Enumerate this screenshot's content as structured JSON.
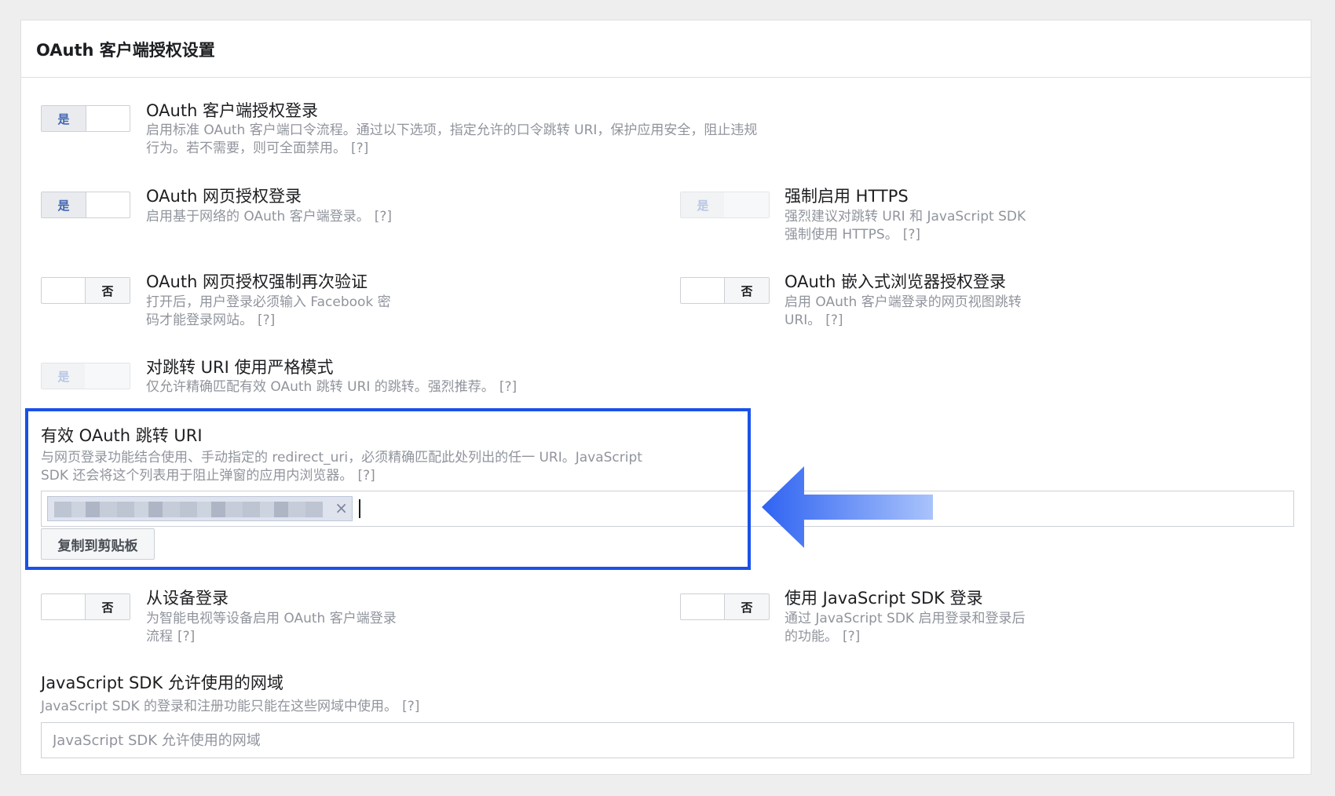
{
  "panel": {
    "title": "OAuth 客户端授权设置"
  },
  "settings": {
    "client_login": {
      "toggle": "是",
      "title": "OAuth 客户端授权登录",
      "desc_line1": "启用标准 OAuth 客户端口令流程。通过以下选项，指定允许的口令跳转 URI，保护应用安全，阻止违规",
      "desc_line2": "行为。若不需要，则可全面禁用。",
      "help": "[?]"
    },
    "web_login": {
      "toggle": "是",
      "title": "OAuth 网页授权登录",
      "desc_line1": "启用基于网络的 OAuth 客户端登录。",
      "help": "[?]"
    },
    "enforce_https": {
      "toggle": "是",
      "title": "强制启用 HTTPS",
      "desc_line1": "强烈建议对跳转 URI 和 JavaScript SDK",
      "desc_line2": "强制使用 HTTPS。",
      "help": "[?]"
    },
    "web_reauth": {
      "toggle": "否",
      "title": "OAuth 网页授权强制再次验证",
      "desc_line1": "打开后，用户登录必须输入 Facebook 密",
      "desc_line2": "码才能登录网站。",
      "help": "[?]"
    },
    "embedded_browser": {
      "toggle": "否",
      "title": "OAuth 嵌入式浏览器授权登录",
      "desc_line1": "启用 OAuth 客户端登录的网页视图跳转",
      "desc_line2": "URI。",
      "help": "[?]"
    },
    "strict_mode": {
      "toggle": "是",
      "title": "对跳转 URI 使用严格模式",
      "desc_line1": "仅允许精确匹配有效 OAuth 跳转 URI 的跳转。强烈推荐。",
      "help": "[?]"
    },
    "device_login": {
      "toggle": "否",
      "title": "从设备登录",
      "desc_line1": "为智能电视等设备启用 OAuth 客户端登录",
      "desc_line2": "流程",
      "help": "[?]"
    },
    "js_sdk_login": {
      "toggle": "否",
      "title": "使用 JavaScript SDK 登录",
      "desc_line1": "通过 JavaScript SDK 启用登录和登录后",
      "desc_line2": "的功能。",
      "help": "[?]"
    }
  },
  "redirect_uri": {
    "title": "有效 OAuth 跳转 URI",
    "desc_line1": "与网页登录功能结合使用、手动指定的 redirect_uri，必须精确匹配此处列出的任一 URI。JavaScript",
    "desc_line2": "SDK 还会将这个列表用于阻止弹窗的应用内浏览器。",
    "help": "[?]",
    "chip_remove": "×",
    "copy_button": "复制到剪贴板"
  },
  "js_domains": {
    "title": "JavaScript SDK 允许使用的网域",
    "desc": "JavaScript SDK 的登录和注册功能只能在这些网域中使用。",
    "help": "[?]",
    "placeholder": "JavaScript SDK 允许使用的网域"
  },
  "colors": {
    "highlight": "#1a51e8",
    "arrow": "#3b6ef5",
    "toggle_on_text": "#4267b2"
  }
}
